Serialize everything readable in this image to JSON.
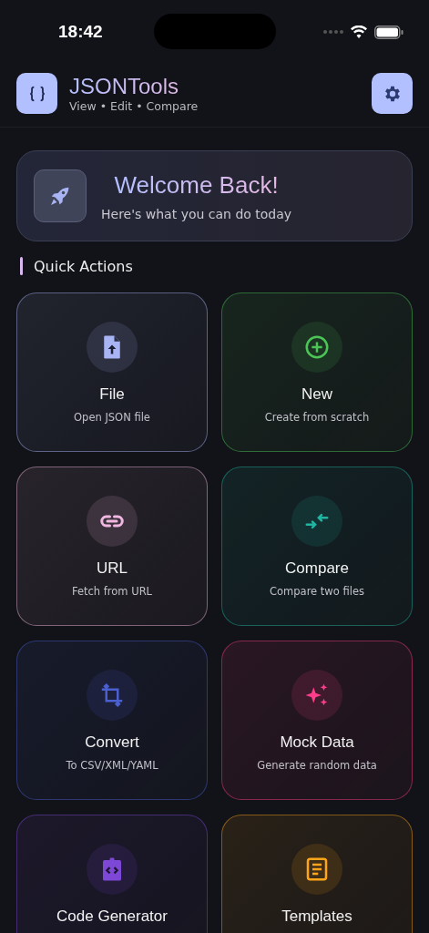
{
  "status_bar": {
    "time": "18:42"
  },
  "header": {
    "app_name": "JSONTools",
    "tagline": "View • Edit • Compare"
  },
  "welcome": {
    "title": "Welcome Back!",
    "subtitle": "Here's what you can do today"
  },
  "section_title": "Quick Actions",
  "actions": [
    {
      "kind": "file",
      "title": "File",
      "subtitle": "Open JSON file",
      "color": "#a9b4f5"
    },
    {
      "kind": "new",
      "title": "New",
      "subtitle": "Create from scratch",
      "color": "#4cc557"
    },
    {
      "kind": "url",
      "title": "URL",
      "subtitle": "Fetch from URL",
      "color": "#f0b8e0"
    },
    {
      "kind": "compare",
      "title": "Compare",
      "subtitle": "Compare two files",
      "color": "#1fb5a0"
    },
    {
      "kind": "convert",
      "title": "Convert",
      "subtitle": "To CSV/XML/YAML",
      "color": "#4a5fd0"
    },
    {
      "kind": "mock",
      "title": "Mock Data",
      "subtitle": "Generate random data",
      "color": "#ff3d8a"
    },
    {
      "kind": "code",
      "title": "Code Generator",
      "color": "#7e48d6"
    },
    {
      "kind": "templates",
      "title": "Templates",
      "color": "#ffa51a"
    }
  ]
}
